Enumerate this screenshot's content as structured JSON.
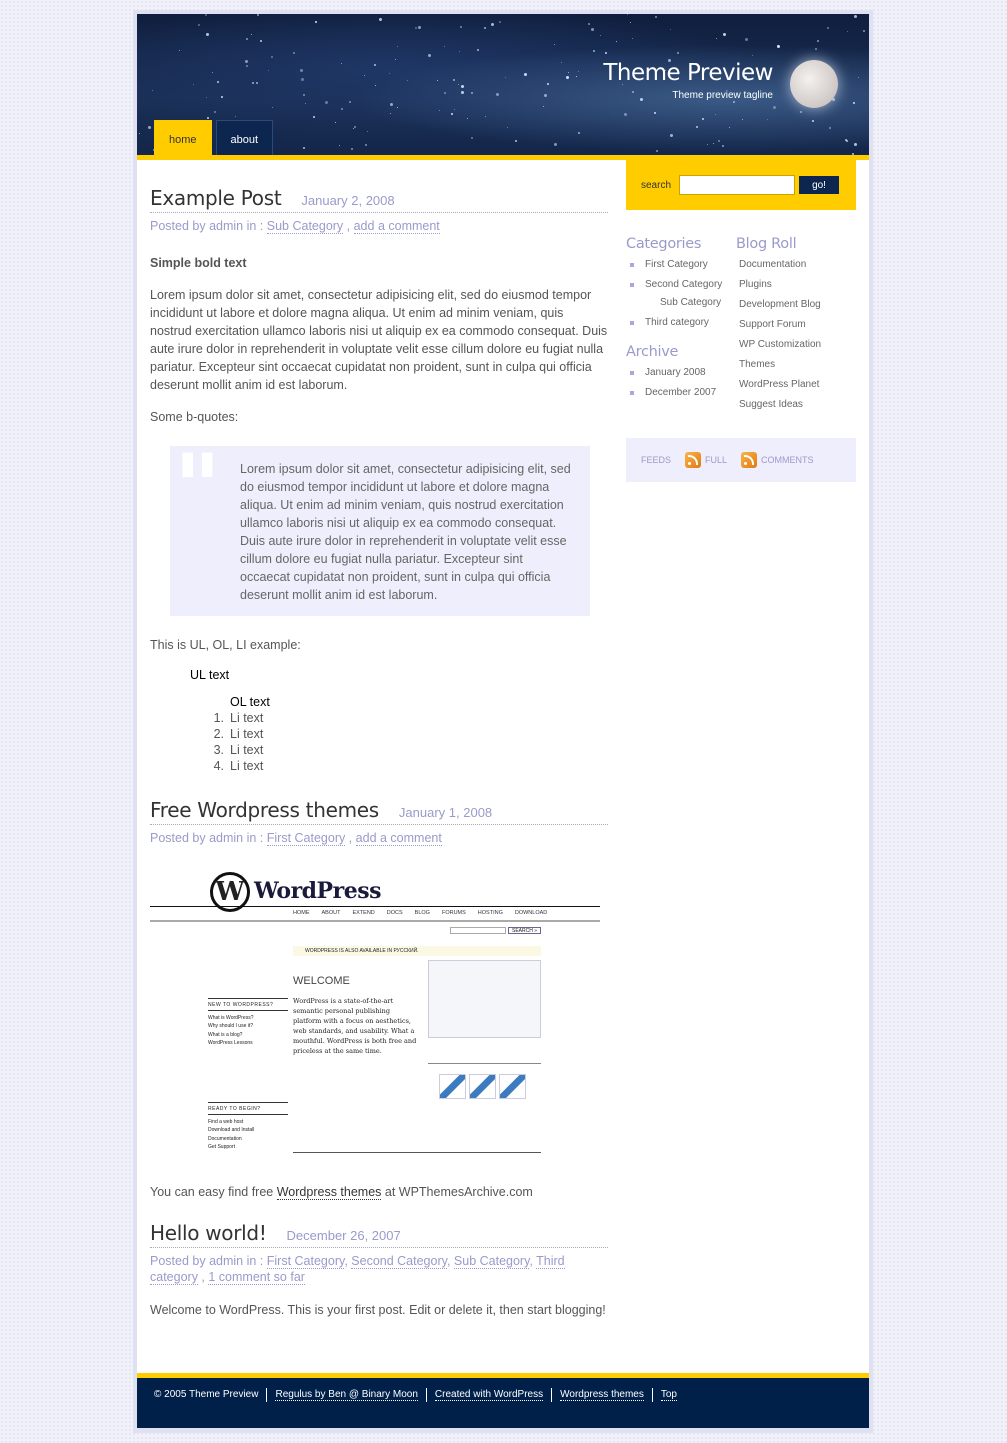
{
  "colors": {
    "accent": "#ffcc00",
    "navy": "#00204a",
    "meta": "#9a9acb",
    "quote_bg": "#eeeefc"
  },
  "header": {
    "title": "Theme Preview",
    "tagline": "Theme preview tagline"
  },
  "nav": [
    {
      "label": "home",
      "active": true
    },
    {
      "label": "about",
      "active": false
    }
  ],
  "posts": [
    {
      "title": "Example Post",
      "date": "January 2, 2008",
      "meta_prefix": "Posted by admin in :",
      "categories": [
        "Sub Category"
      ],
      "comment_link": "add a comment",
      "bold": "Simple bold text",
      "para": "Lorem ipsum dolor sit amet, consectetur adipisicing elit, sed do eiusmod tempor incididunt ut labore et dolore magna aliqua. Ut enim ad minim veniam, quis nostrud exercitation ullamco laboris nisi ut aliquip ex ea commodo consequat. Duis aute irure dolor in reprehenderit in voluptate velit esse cillum dolore eu fugiat nulla pariatur. Excepteur sint occaecat cupidatat non proident, sunt in culpa qui officia deserunt mollit anim id est laborum.",
      "bq_intro": "Some b-quotes:",
      "blockquote": "Lorem ipsum dolor sit amet, consectetur adipisicing elit, sed do eiusmod tempor incididunt ut labore et dolore magna aliqua. Ut enim ad minim veniam, quis nostrud exercitation ullamco laboris nisi ut aliquip ex ea commodo consequat. Duis aute irure dolor in reprehenderit in voluptate velit esse cillum dolore eu fugiat nulla pariatur. Excepteur sint occaecat cupidatat non proident, sunt in culpa qui officia deserunt mollit anim id est laborum.",
      "list_intro": "This is UL, OL, LI example:",
      "ul_text": "UL text",
      "ol_text": "OL text",
      "li": [
        "Li text",
        "Li text",
        "Li text",
        "Li text"
      ]
    },
    {
      "title": "Free Wordpress themes",
      "date": "January 1, 2008",
      "meta_prefix": "Posted by admin in :",
      "categories": [
        "First Category"
      ],
      "comment_link": "add a comment",
      "image": {
        "logo": "WordPress",
        "nav": [
          "HOME",
          "ABOUT",
          "EXTEND",
          "DOCS",
          "BLOG",
          "FORUMS",
          "HOSTING",
          "DOWNLOAD"
        ],
        "search": "SEARCH »",
        "notice": "WORDPRESS IS ALSO AVAILABLE IN РУССКИЙ.",
        "welcome": "WELCOME",
        "text": "WordPress is a state-of-the-art semantic personal publishing platform with a focus on aesthetics, web standards, and usability. What a mouthful. WordPress is both free and priceless at the same time.",
        "side1_title": "NEW TO WORDPRESS?",
        "side1": [
          "What is WordPress?",
          "Why should I use it?",
          "What is a blog?",
          "WordPress Lessons"
        ],
        "side2_title": "READY TO BEGIN?",
        "side2": [
          "Find a web host",
          "Download and Install",
          "Documentation",
          "Get Support"
        ]
      },
      "after_prefix": "You can easy find free",
      "after_link": "Wordpress themes",
      "after_suffix": "at WPThemesArchive.com"
    },
    {
      "title": "Hello world!",
      "date": "December 26, 2007",
      "meta_prefix": "Posted by admin in :",
      "categories": [
        "First Category",
        "Second Category",
        "Sub Category",
        "Third category"
      ],
      "comment_link": "1 comment so far",
      "para": "Welcome to WordPress. This is your first post. Edit or delete it, then start blogging!"
    }
  ],
  "sidebar": {
    "search_label": "search",
    "search_value": "",
    "search_button": "go!",
    "categories_title": "Categories",
    "categories": [
      {
        "label": "First Category",
        "level": 0
      },
      {
        "label": "Second Category",
        "level": 0
      },
      {
        "label": "Sub Category",
        "level": 1
      },
      {
        "label": "Third category",
        "level": 0
      }
    ],
    "archive_title": "Archive",
    "archive": [
      "January 2008",
      "December 2007"
    ],
    "blogroll_title": "Blog Roll",
    "blogroll": [
      "Documentation",
      "Plugins",
      "Development Blog",
      "Support Forum",
      "WP Customization",
      "Themes",
      "WordPress Planet",
      "Suggest Ideas"
    ],
    "feeds_label": "FEEDS",
    "feed_full": "FULL",
    "feed_comments": "COMMENTS"
  },
  "footer": {
    "copyright": "© 2005 Theme Preview",
    "links": [
      "Regulus by Ben @ Binary Moon",
      "Created with WordPress",
      "Wordpress themes",
      "Top"
    ]
  }
}
